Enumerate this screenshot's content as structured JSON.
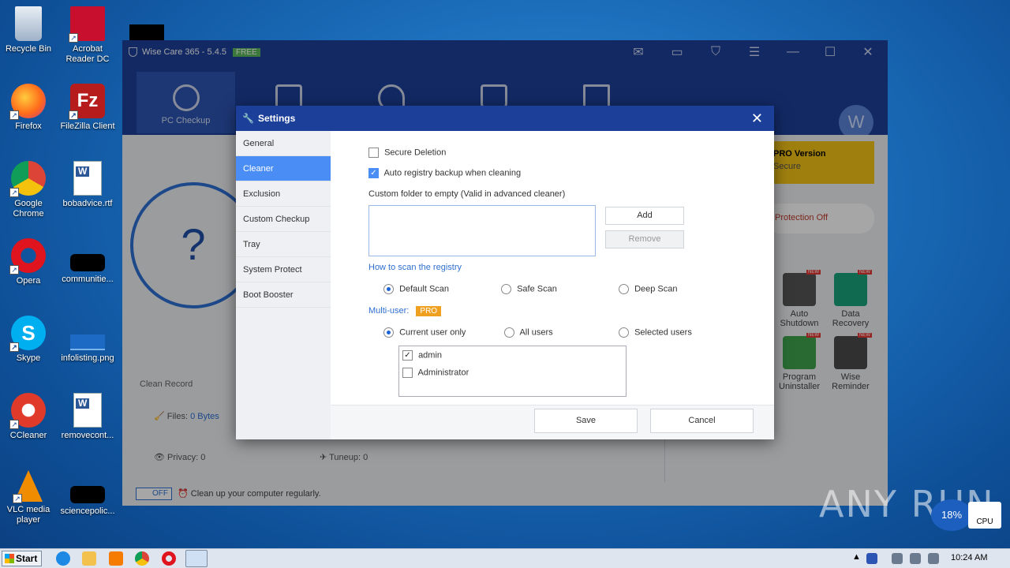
{
  "desktop": {
    "icons": [
      {
        "label": "Recycle Bin"
      },
      {
        "label": "Acrobat Reader DC"
      },
      {
        "label": "Firefox"
      },
      {
        "label": "FileZilla Client"
      },
      {
        "label": "Google Chrome"
      },
      {
        "label": "bobadvice.rtf"
      },
      {
        "label": "Opera"
      },
      {
        "label": "communitie..."
      },
      {
        "label": "Skype"
      },
      {
        "label": "infolisting.png"
      },
      {
        "label": "CCleaner"
      },
      {
        "label": "removecont..."
      },
      {
        "label": "VLC media player"
      },
      {
        "label": "sciencepolic..."
      }
    ]
  },
  "app": {
    "title": "Wise Care 365 - 5.4.5",
    "badge": "FREE",
    "nav_active": "PC Checkup",
    "pro_version": "PRO Version",
    "pro_sub": "Secure",
    "protection": "Protection Off",
    "clean_record": "Clean Record",
    "files_label": "Files:",
    "files_value": "0 Bytes",
    "privacy": "Privacy: 0",
    "tuneup": "Tuneup: 0",
    "toggle": "OFF",
    "schedule_text": "Clean up your computer regularly.",
    "tools": [
      {
        "label": "Auto Shutdown",
        "badge": "NEW"
      },
      {
        "label": "Data Recovery",
        "badge": "NEW"
      },
      {
        "label": "Program Uninstaller",
        "badge": "NEW"
      },
      {
        "label": "Wise Reminder",
        "badge": "NEW"
      }
    ],
    "question": "?"
  },
  "dialog": {
    "title": "Settings",
    "sidebar": [
      "General",
      "Cleaner",
      "Exclusion",
      "Custom Checkup",
      "Tray",
      "System Protect",
      "Boot Booster"
    ],
    "active_item": "Cleaner",
    "secure_deletion": "Secure Deletion",
    "auto_backup": "Auto registry backup when cleaning",
    "custom_folder": "Custom folder to empty (Valid in advanced cleaner)",
    "add": "Add",
    "remove": "Remove",
    "registry_heading": "How to scan the registry",
    "scan_options": [
      "Default Scan",
      "Safe Scan",
      "Deep Scan"
    ],
    "multiuser_label": "Multi-user:",
    "pro_badge": "PRO",
    "user_options": [
      "Current user only",
      "All users",
      "Selected users"
    ],
    "users": [
      {
        "name": "admin",
        "checked": true
      },
      {
        "name": "Administrator",
        "checked": false
      }
    ],
    "save": "Save",
    "cancel": "Cancel"
  },
  "taskbar": {
    "start": "Start",
    "clock": "10:24 AM",
    "cpu_percent": "18%",
    "cpu_label": "CPU"
  },
  "watermark": "ANY RUN"
}
